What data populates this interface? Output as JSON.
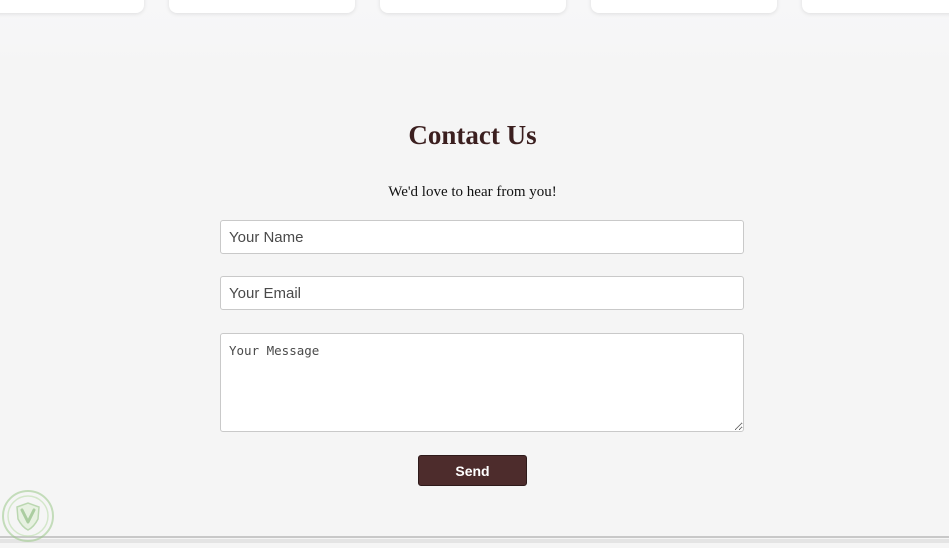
{
  "contact": {
    "title": "Contact Us",
    "subtitle": "We'd love to hear from you!",
    "name_placeholder": "Your Name",
    "email_placeholder": "Your Email",
    "message_placeholder": "Your Message",
    "send_label": "Send"
  },
  "colors": {
    "page_background": "#f5f5f5",
    "title": "#3b1f1f",
    "button_background": "#4d2c2c",
    "button_text": "#ffffff"
  },
  "icons": {
    "watermark": "green-shield-logo-icon"
  }
}
